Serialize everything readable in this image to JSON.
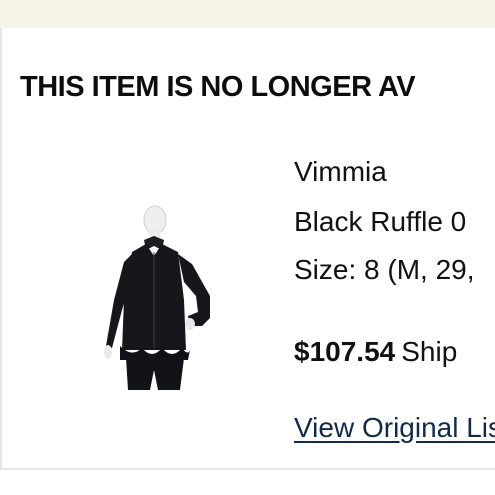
{
  "banner": {},
  "headline": "THIS ITEM IS NO LONGER AV",
  "product": {
    "brand": "Vimmia",
    "title": "Black Ruffle 0",
    "size": "Size: 8 (M, 29,",
    "price": "$107.54",
    "shipping": "Ship",
    "view_link": "View Original Lis"
  }
}
